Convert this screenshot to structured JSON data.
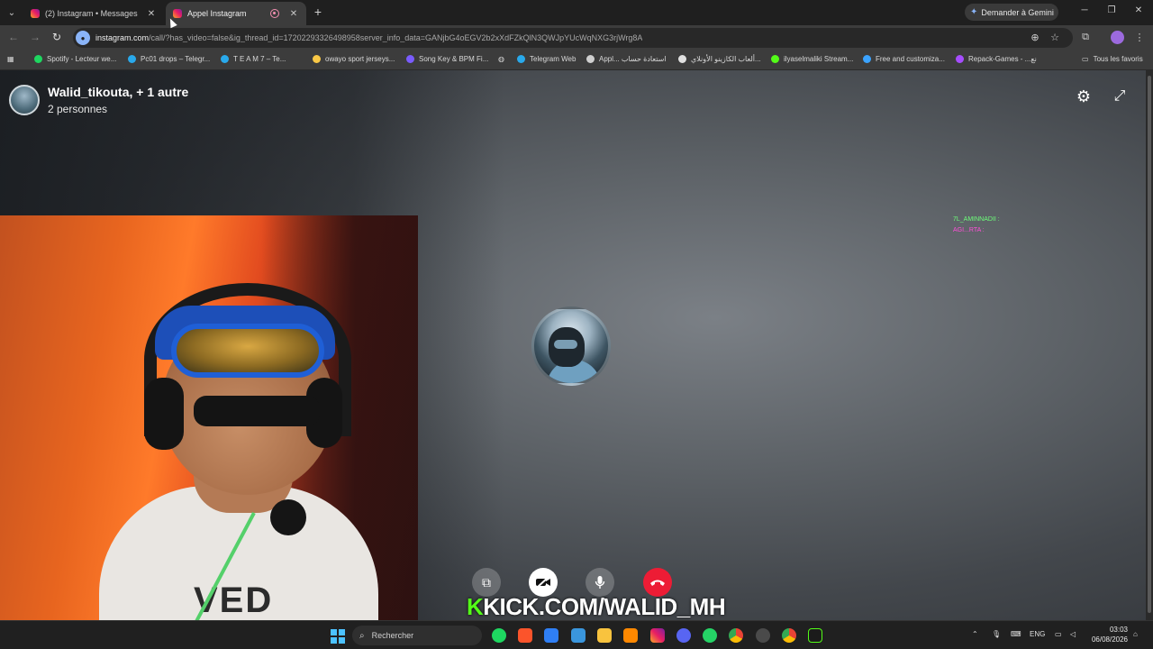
{
  "browser": {
    "tabs": [
      {
        "title": "(2) Instagram • Messages",
        "active": false
      },
      {
        "title": "Appel Instagram",
        "active": true
      }
    ],
    "gemini_label": "Demander à Gemini",
    "url_host": "instagram.com",
    "url_rest": "/call/?has_video=false&ig_thread_id=17202293326498958server_info_data=GANjbG4oEGV2b2xXdFZkQlN3QWJpYUcWqNXG3rjWrg8A",
    "bookmarks": [
      "Spotify - Lecteur we...",
      "Pc01 drops – Telegr...",
      "T E A M 7 – Te...",
      "owayo sport jerseys...",
      "Song Key & BPM Fi...",
      "Telegram Web",
      "Appl... استعادة حساب",
      "ألعاب الكازينو الأونلاي...",
      "ilyaselmaliki Stream...",
      "Free and customiza...",
      "Repack-Games - ...نع"
    ],
    "all_bookmarks": "Tous les favoris"
  },
  "call": {
    "title": "Walid_tikouta, + 1 autre",
    "subtitle": "2 personnes",
    "chat": [
      {
        "user": "7L_AMINNADII :",
        "color": "#6dff7a"
      },
      {
        "user": "AGI...RTA :",
        "color": "#ff4fd8"
      }
    ],
    "self_view_logo": "VED",
    "overlay_text": "KICK.COM/WALID_MH",
    "overlay_k": "K"
  },
  "taskbar": {
    "search_label": "Rechercher",
    "lang": "ENG",
    "time": "03:03",
    "date": "06/08/2026"
  },
  "colors": {
    "accent_end_call": "#ed1c35",
    "kick_green": "#53fc18"
  },
  "icons": [
    "tab-menu-icon",
    "instagram-icon",
    "close-icon",
    "record-icon",
    "plus-icon",
    "gemini-spark-icon",
    "minimize-icon",
    "maximize-icon",
    "window-close-icon",
    "back-icon",
    "forward-icon",
    "reload-icon",
    "site-info-icon",
    "zoom-icon",
    "star-icon",
    "extensions-icon",
    "more-icon",
    "apps-icon",
    "folder-icon",
    "settings-gear-icon",
    "fullscreen-icon",
    "share-screen-icon",
    "video-off-icon",
    "microphone-icon",
    "end-call-icon",
    "windows-start-icon",
    "search-icon"
  ]
}
